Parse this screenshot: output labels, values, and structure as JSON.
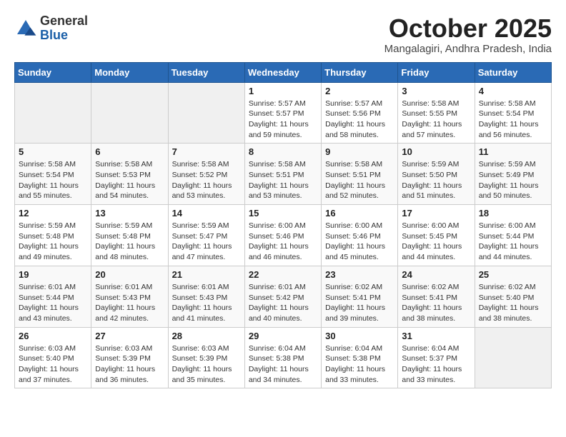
{
  "header": {
    "logo_line1": "General",
    "logo_line2": "Blue",
    "month": "October 2025",
    "location": "Mangalagiri, Andhra Pradesh, India"
  },
  "weekdays": [
    "Sunday",
    "Monday",
    "Tuesday",
    "Wednesday",
    "Thursday",
    "Friday",
    "Saturday"
  ],
  "weeks": [
    [
      {
        "day": "",
        "info": ""
      },
      {
        "day": "",
        "info": ""
      },
      {
        "day": "",
        "info": ""
      },
      {
        "day": "1",
        "info": "Sunrise: 5:57 AM\nSunset: 5:57 PM\nDaylight: 11 hours and 59 minutes."
      },
      {
        "day": "2",
        "info": "Sunrise: 5:57 AM\nSunset: 5:56 PM\nDaylight: 11 hours and 58 minutes."
      },
      {
        "day": "3",
        "info": "Sunrise: 5:58 AM\nSunset: 5:55 PM\nDaylight: 11 hours and 57 minutes."
      },
      {
        "day": "4",
        "info": "Sunrise: 5:58 AM\nSunset: 5:54 PM\nDaylight: 11 hours and 56 minutes."
      }
    ],
    [
      {
        "day": "5",
        "info": "Sunrise: 5:58 AM\nSunset: 5:54 PM\nDaylight: 11 hours and 55 minutes."
      },
      {
        "day": "6",
        "info": "Sunrise: 5:58 AM\nSunset: 5:53 PM\nDaylight: 11 hours and 54 minutes."
      },
      {
        "day": "7",
        "info": "Sunrise: 5:58 AM\nSunset: 5:52 PM\nDaylight: 11 hours and 53 minutes."
      },
      {
        "day": "8",
        "info": "Sunrise: 5:58 AM\nSunset: 5:51 PM\nDaylight: 11 hours and 53 minutes."
      },
      {
        "day": "9",
        "info": "Sunrise: 5:58 AM\nSunset: 5:51 PM\nDaylight: 11 hours and 52 minutes."
      },
      {
        "day": "10",
        "info": "Sunrise: 5:59 AM\nSunset: 5:50 PM\nDaylight: 11 hours and 51 minutes."
      },
      {
        "day": "11",
        "info": "Sunrise: 5:59 AM\nSunset: 5:49 PM\nDaylight: 11 hours and 50 minutes."
      }
    ],
    [
      {
        "day": "12",
        "info": "Sunrise: 5:59 AM\nSunset: 5:48 PM\nDaylight: 11 hours and 49 minutes."
      },
      {
        "day": "13",
        "info": "Sunrise: 5:59 AM\nSunset: 5:48 PM\nDaylight: 11 hours and 48 minutes."
      },
      {
        "day": "14",
        "info": "Sunrise: 5:59 AM\nSunset: 5:47 PM\nDaylight: 11 hours and 47 minutes."
      },
      {
        "day": "15",
        "info": "Sunrise: 6:00 AM\nSunset: 5:46 PM\nDaylight: 11 hours and 46 minutes."
      },
      {
        "day": "16",
        "info": "Sunrise: 6:00 AM\nSunset: 5:46 PM\nDaylight: 11 hours and 45 minutes."
      },
      {
        "day": "17",
        "info": "Sunrise: 6:00 AM\nSunset: 5:45 PM\nDaylight: 11 hours and 44 minutes."
      },
      {
        "day": "18",
        "info": "Sunrise: 6:00 AM\nSunset: 5:44 PM\nDaylight: 11 hours and 44 minutes."
      }
    ],
    [
      {
        "day": "19",
        "info": "Sunrise: 6:01 AM\nSunset: 5:44 PM\nDaylight: 11 hours and 43 minutes."
      },
      {
        "day": "20",
        "info": "Sunrise: 6:01 AM\nSunset: 5:43 PM\nDaylight: 11 hours and 42 minutes."
      },
      {
        "day": "21",
        "info": "Sunrise: 6:01 AM\nSunset: 5:43 PM\nDaylight: 11 hours and 41 minutes."
      },
      {
        "day": "22",
        "info": "Sunrise: 6:01 AM\nSunset: 5:42 PM\nDaylight: 11 hours and 40 minutes."
      },
      {
        "day": "23",
        "info": "Sunrise: 6:02 AM\nSunset: 5:41 PM\nDaylight: 11 hours and 39 minutes."
      },
      {
        "day": "24",
        "info": "Sunrise: 6:02 AM\nSunset: 5:41 PM\nDaylight: 11 hours and 38 minutes."
      },
      {
        "day": "25",
        "info": "Sunrise: 6:02 AM\nSunset: 5:40 PM\nDaylight: 11 hours and 38 minutes."
      }
    ],
    [
      {
        "day": "26",
        "info": "Sunrise: 6:03 AM\nSunset: 5:40 PM\nDaylight: 11 hours and 37 minutes."
      },
      {
        "day": "27",
        "info": "Sunrise: 6:03 AM\nSunset: 5:39 PM\nDaylight: 11 hours and 36 minutes."
      },
      {
        "day": "28",
        "info": "Sunrise: 6:03 AM\nSunset: 5:39 PM\nDaylight: 11 hours and 35 minutes."
      },
      {
        "day": "29",
        "info": "Sunrise: 6:04 AM\nSunset: 5:38 PM\nDaylight: 11 hours and 34 minutes."
      },
      {
        "day": "30",
        "info": "Sunrise: 6:04 AM\nSunset: 5:38 PM\nDaylight: 11 hours and 33 minutes."
      },
      {
        "day": "31",
        "info": "Sunrise: 6:04 AM\nSunset: 5:37 PM\nDaylight: 11 hours and 33 minutes."
      },
      {
        "day": "",
        "info": ""
      }
    ]
  ]
}
